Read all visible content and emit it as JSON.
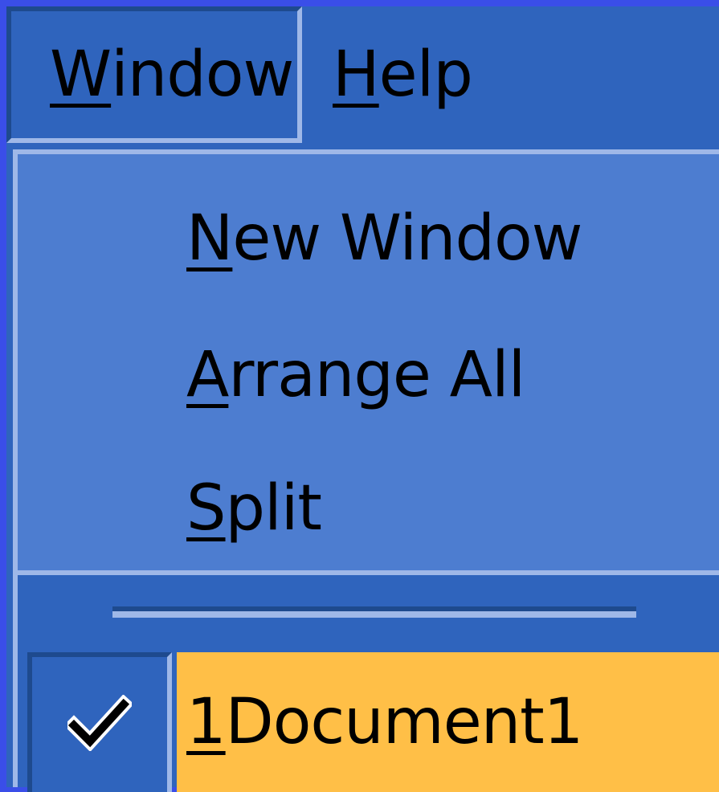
{
  "menubar": {
    "window_label_first": "W",
    "window_label_rest": "indow",
    "help_label_first": "H",
    "help_label_rest": "elp"
  },
  "window_menu": {
    "items": [
      {
        "first": "N",
        "rest": "ew Window"
      },
      {
        "first": "A",
        "rest": "rrange All"
      },
      {
        "first": "S",
        "rest": "plit"
      }
    ],
    "documents": [
      {
        "first": "1",
        "rest": " Document1",
        "checked": true
      }
    ]
  },
  "colors": {
    "menubar_bg": "#2f64bd",
    "menu_group_bg": "#4d7dd0",
    "highlight_bg": "#ffbf47",
    "frame_border": "#3a4ee8"
  },
  "icons": {
    "check": "check-icon"
  }
}
